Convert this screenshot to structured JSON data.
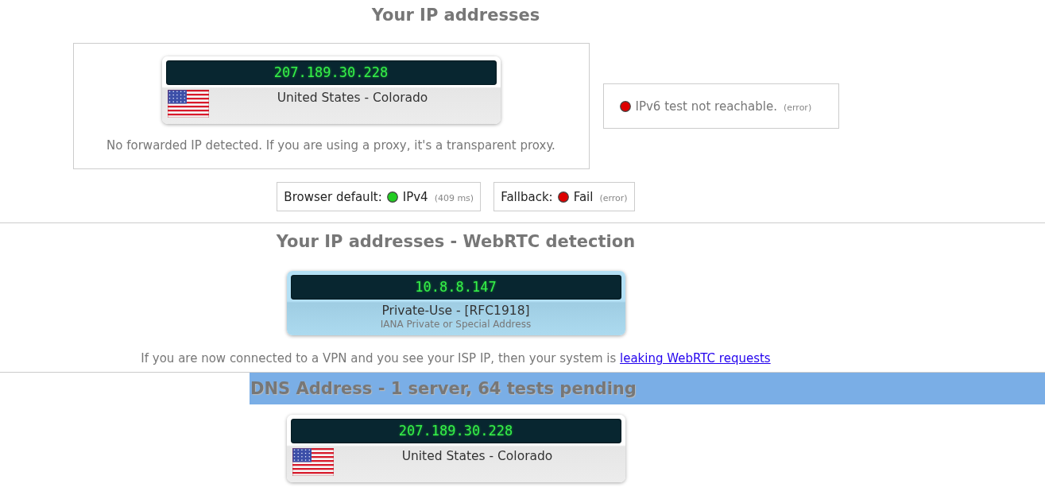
{
  "ip_section": {
    "title": "Your IP addresses",
    "card": {
      "kind": "geo",
      "ip": "207.189.30.228",
      "location": "United States - Colorado"
    },
    "forward_note": "No forwarded IP detected. If you are using a proxy, it's a transparent proxy.",
    "ipv6_status": {
      "color": "#dd0000",
      "text": "IPv6 test not reachable.",
      "detail": "(error)"
    },
    "protocol_checks": [
      {
        "label": "Browser default:",
        "color": "#22cc22",
        "value": "IPv4",
        "detail": "(409 ms)"
      },
      {
        "label": "Fallback:",
        "color": "#dd0000",
        "value": "Fail",
        "detail": "(error)"
      }
    ]
  },
  "webrtc_section": {
    "title": "Your IP addresses - WebRTC detection",
    "card": {
      "kind": "private",
      "ip": "10.8.8.147",
      "name": "Private-Use - [RFC1918]",
      "description": "IANA Private or Special Address"
    },
    "note": "If you are now connected to a VPN and you see your ISP IP, then your system is",
    "note_link": "leaking WebRTC requests"
  },
  "dns_section": {
    "title": "DNS Address - 1 server, 64 tests pending",
    "card": {
      "kind": "geo",
      "ip": "207.189.30.228",
      "location": "United States - Colorado"
    }
  }
}
